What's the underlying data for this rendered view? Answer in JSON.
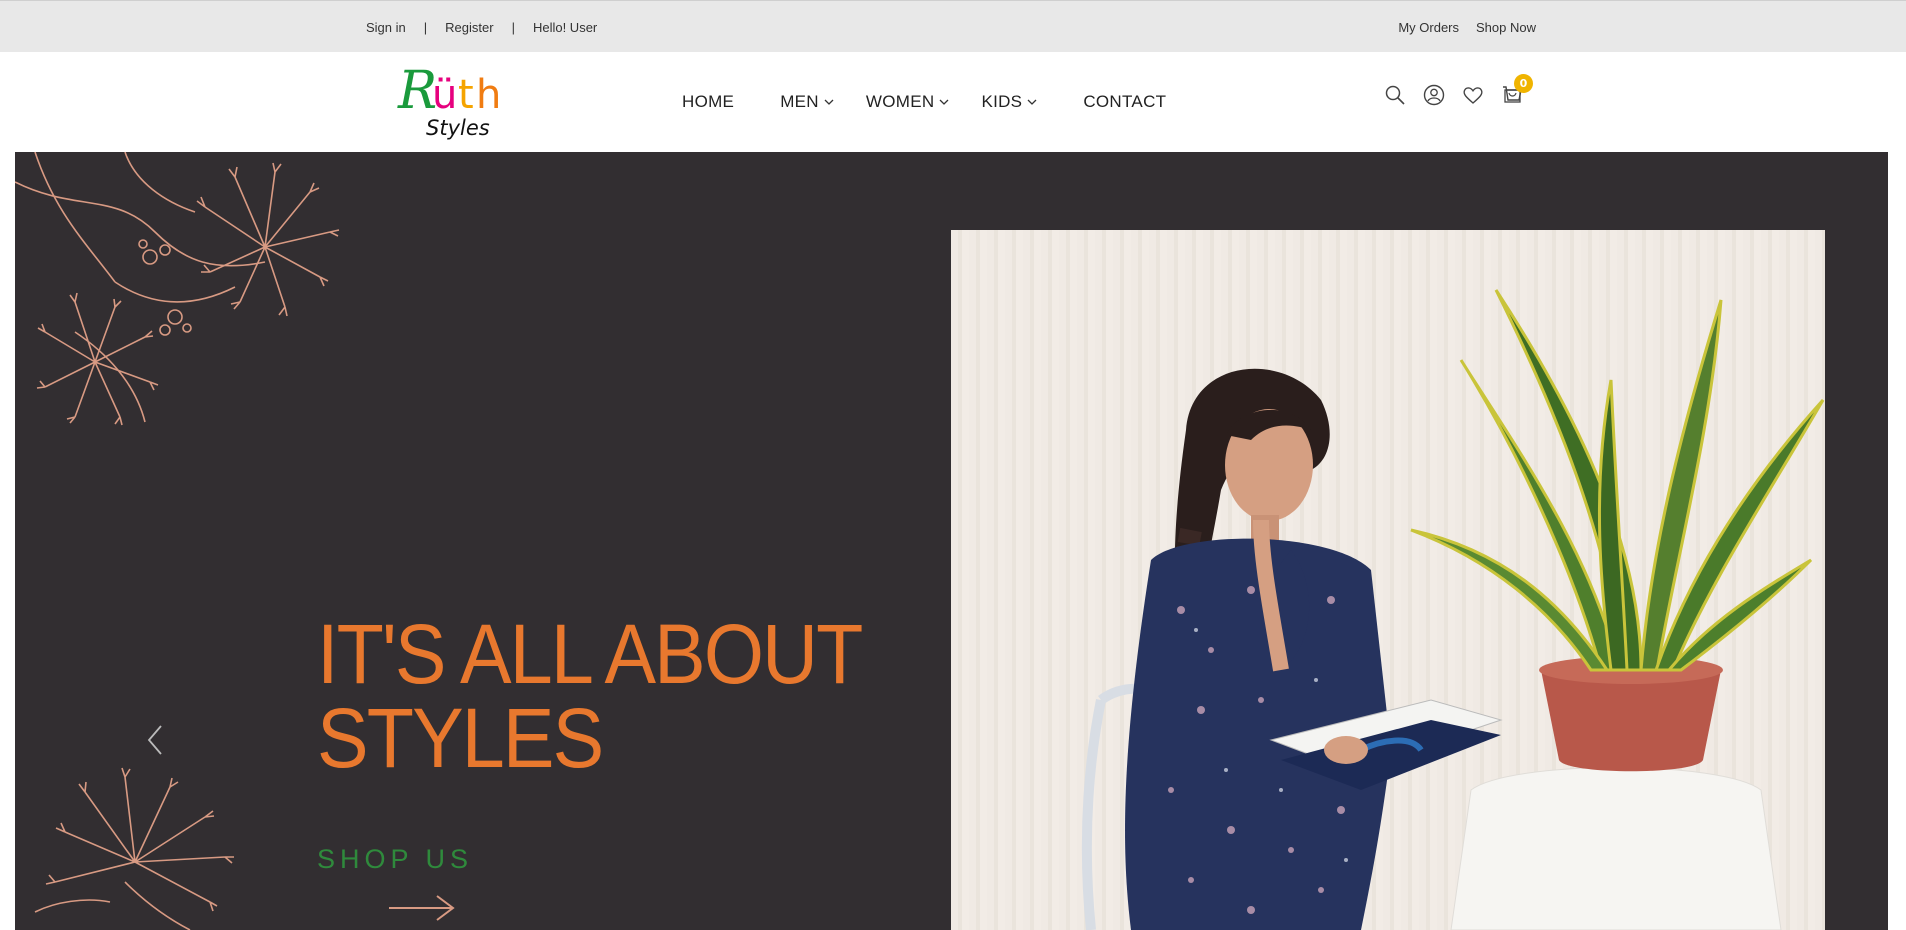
{
  "topbar": {
    "sign_in": "Sign in",
    "separator": "|",
    "register": "Register",
    "greeting": "Hello! User",
    "my_orders": "My Orders",
    "shop_now": "Shop Now"
  },
  "brand": {
    "logo_main": "Rüth",
    "logo_sub": "Styles"
  },
  "nav": {
    "home": "HOME",
    "men": "MEN",
    "women": "WOMEN",
    "kids": "KIDS",
    "contact": "CONTACT"
  },
  "header_icons": [
    "search-icon",
    "user-icon",
    "heart-icon",
    "cart-icon"
  ],
  "cart": {
    "count": "0"
  },
  "hero": {
    "headline_line1": "IT'S ALL ABOUT",
    "headline_line2": "STYLES",
    "cta": "SHOP US"
  },
  "colors": {
    "topbar_bg": "#e8e8e8",
    "hero_bg": "#322e31",
    "headline": "#e8782e",
    "cta": "#2f8a3c",
    "floral": "#d89a83",
    "badge": "#f0b400"
  }
}
